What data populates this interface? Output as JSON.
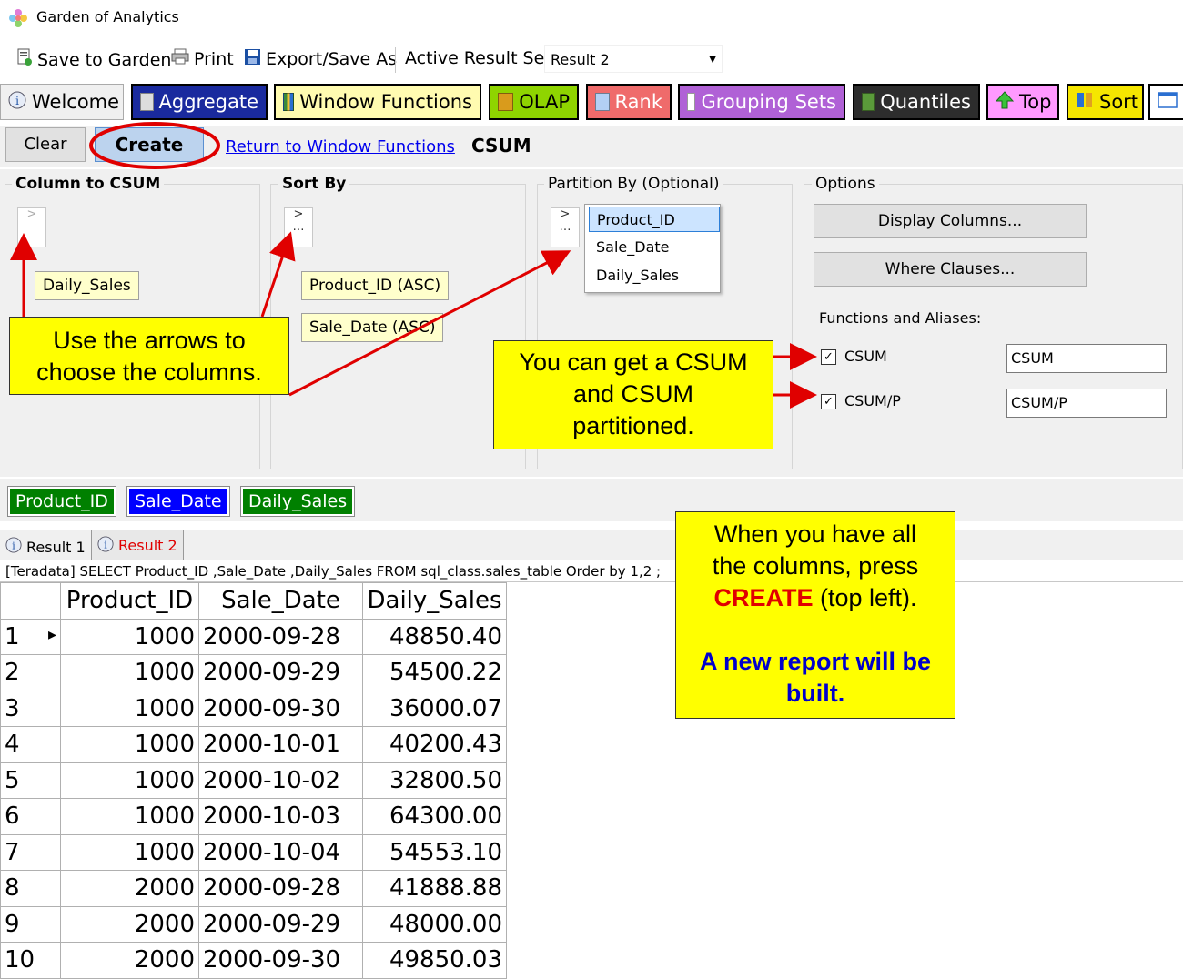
{
  "app": {
    "title": "Garden of Analytics"
  },
  "toolbar": {
    "save_to_garden": "Save to Garden",
    "print": "Print",
    "export": "Export/Save As",
    "active_result_label": "Active Result Set:",
    "active_result_value": "Result 2"
  },
  "tabs": {
    "welcome": "Welcome",
    "aggregate": "Aggregate",
    "window_functions": "Window Functions",
    "olap": "OLAP",
    "rank": "Rank",
    "grouping_sets": "Grouping Sets",
    "quantiles": "Quantiles",
    "top": "Top",
    "sort": "Sort"
  },
  "actions": {
    "clear": "Clear",
    "create": "Create",
    "return_link": "Return to Window Functions",
    "function_name": "CSUM"
  },
  "panels": {
    "column_to_csum": {
      "label": "Column to CSUM",
      "chips": [
        "Daily_Sales"
      ]
    },
    "sort_by": {
      "label": "Sort By",
      "chips": [
        "Product_ID (ASC)",
        "Sale_Date (ASC)"
      ]
    },
    "partition_by": {
      "label": "Partition By (Optional)",
      "items": [
        "Product_ID",
        "Sale_Date",
        "Daily_Sales"
      ],
      "selected": "Product_ID"
    },
    "options": {
      "label": "Options",
      "display_columns": "Display Columns...",
      "where_clauses": "Where Clauses...",
      "functions_label": "Functions and Aliases:",
      "functions": [
        {
          "name": "CSUM",
          "alias": "CSUM",
          "checked": true
        },
        {
          "name": "CSUM/P",
          "alias": "CSUM/P",
          "checked": true
        }
      ]
    }
  },
  "column_chips": [
    {
      "label": "Product_ID",
      "color": "#008000"
    },
    {
      "label": "Sale_Date",
      "color": "#0000ff"
    },
    {
      "label": "Daily_Sales",
      "color": "#008000"
    }
  ],
  "result_tabs": [
    "Result 1",
    "Result 2"
  ],
  "sql": "[Teradata] SELECT Product_ID ,Sale_Date ,Daily_Sales FROM sql_class.sales_table Order by 1,2 ;",
  "grid": {
    "columns": [
      "Product_ID",
      "Sale_Date",
      "Daily_Sales"
    ],
    "rows": [
      [
        "1",
        "1000",
        "2000-09-28",
        "48850.40"
      ],
      [
        "2",
        "1000",
        "2000-09-29",
        "54500.22"
      ],
      [
        "3",
        "1000",
        "2000-09-30",
        "36000.07"
      ],
      [
        "4",
        "1000",
        "2000-10-01",
        "40200.43"
      ],
      [
        "5",
        "1000",
        "2000-10-02",
        "32800.50"
      ],
      [
        "6",
        "1000",
        "2000-10-03",
        "64300.00"
      ],
      [
        "7",
        "1000",
        "2000-10-04",
        "54553.10"
      ],
      [
        "8",
        "2000",
        "2000-09-28",
        "41888.88"
      ],
      [
        "9",
        "2000",
        "2000-09-29",
        "48000.00"
      ],
      [
        "10",
        "2000",
        "2000-09-30",
        "49850.03"
      ]
    ]
  },
  "callouts": {
    "arrows": {
      "line1": "Use the arrows to",
      "line2": "choose the columns."
    },
    "csum": {
      "line1": "You can get a CSUM",
      "line2": "and CSUM",
      "line3": "partitioned."
    },
    "create": {
      "line1": "When you have all",
      "line2": "the columns, press",
      "create_word": "CREATE",
      "line3_rest": " (top left).",
      "line4": "A new report will be",
      "line5": "built."
    }
  },
  "colors": {
    "annotation_red": "#e00000",
    "callout_yellow": "#ffff00",
    "callout_blue": "#0000cc"
  }
}
